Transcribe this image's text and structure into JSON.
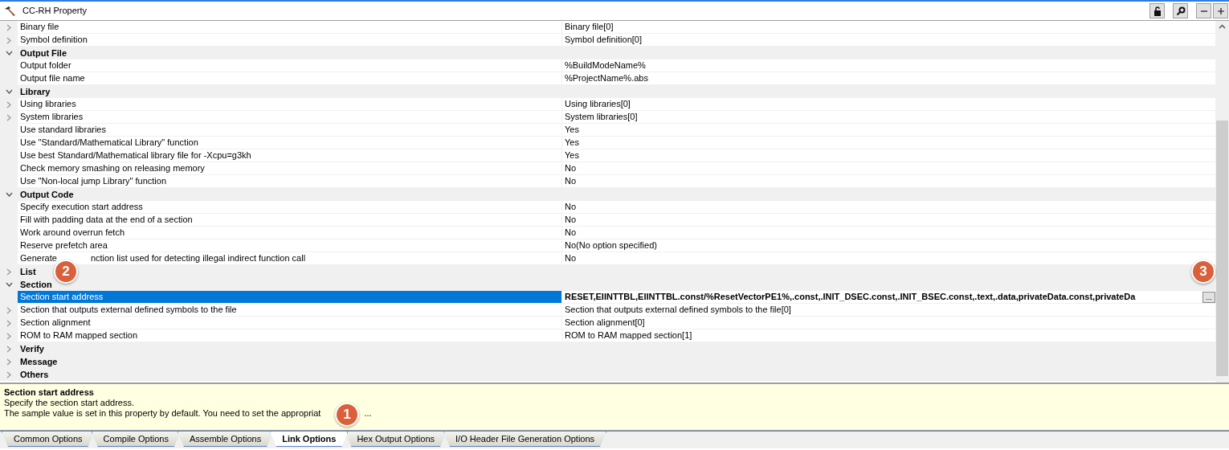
{
  "window": {
    "title": "CC-RH Property"
  },
  "toolbar": [
    {
      "kind": "lock"
    },
    {
      "kind": "search"
    },
    {
      "kind": "minus"
    },
    {
      "kind": "plus"
    }
  ],
  "rows": [
    {
      "kind": "property",
      "name": "Binary file",
      "value": "Binary file[0]",
      "expandable": true,
      "selected": false,
      "modified": false
    },
    {
      "kind": "property",
      "name": "Symbol definition",
      "value": "Symbol definition[0]",
      "expandable": true,
      "selected": false,
      "modified": false
    },
    {
      "kind": "category",
      "name": "Output File",
      "expanded": true
    },
    {
      "kind": "property",
      "name": "Output folder",
      "value": "%BuildModeName%",
      "expandable": false,
      "selected": false,
      "modified": false
    },
    {
      "kind": "property",
      "name": "Output file name",
      "value": "%ProjectName%.abs",
      "expandable": false,
      "selected": false,
      "modified": false
    },
    {
      "kind": "category",
      "name": "Library",
      "expanded": true
    },
    {
      "kind": "property",
      "name": "Using libraries",
      "value": "Using libraries[0]",
      "expandable": true,
      "selected": false,
      "modified": false
    },
    {
      "kind": "property",
      "name": "System libraries",
      "value": "System libraries[0]",
      "expandable": true,
      "selected": false,
      "modified": false
    },
    {
      "kind": "property",
      "name": "Use standard libraries",
      "value": "Yes",
      "expandable": false,
      "selected": false,
      "modified": false
    },
    {
      "kind": "property",
      "name": "Use \"Standard/Mathematical Library\" function",
      "value": "Yes",
      "expandable": false,
      "selected": false,
      "modified": false
    },
    {
      "kind": "property",
      "name": "Use best Standard/Mathematical library file for -Xcpu=g3kh",
      "value": "Yes",
      "expandable": false,
      "selected": false,
      "modified": false
    },
    {
      "kind": "property",
      "name": "Check memory smashing on releasing memory",
      "value": "No",
      "expandable": false,
      "selected": false,
      "modified": false
    },
    {
      "kind": "property",
      "name": "Use \"Non-local jump Library\" function",
      "value": "No",
      "expandable": false,
      "selected": false,
      "modified": false
    },
    {
      "kind": "category",
      "name": "Output Code",
      "expanded": true
    },
    {
      "kind": "property",
      "name": "Specify execution start address",
      "value": "No",
      "expandable": false,
      "selected": false,
      "modified": false
    },
    {
      "kind": "property",
      "name": "Fill with padding data at the end of a section",
      "value": "No",
      "expandable": false,
      "selected": false,
      "modified": false
    },
    {
      "kind": "property",
      "name": "Work around overrun fetch",
      "value": "No",
      "expandable": false,
      "selected": false,
      "modified": false
    },
    {
      "kind": "property",
      "name": "Reserve prefetch area",
      "value": "No(No option specified)",
      "expandable": false,
      "selected": false,
      "modified": false
    },
    {
      "kind": "property",
      "name": "Generate",
      "name_rest": "nction list used for detecting illegal indirect function call",
      "value": "No",
      "expandable": false,
      "selected": false,
      "modified": false
    },
    {
      "kind": "category",
      "name": "List",
      "expanded": false
    },
    {
      "kind": "category",
      "name": "Section",
      "expanded": true
    },
    {
      "kind": "property",
      "name": "Section start address",
      "value": "RESET,EIINTTBL,EIINTTBL.const/%ResetVectorPE1%,.const,.INIT_DSEC.const,.INIT_BSEC.const,.text,.data,privateData.const,privateDa",
      "expandable": false,
      "selected": true,
      "modified": true,
      "button": "..."
    },
    {
      "kind": "property",
      "name": "Section that outputs external defined symbols to the file",
      "value": "Section that outputs external defined symbols to the file[0]",
      "expandable": true,
      "selected": false,
      "modified": false
    },
    {
      "kind": "property",
      "name": "Section alignment",
      "value": "Section alignment[0]",
      "expandable": true,
      "selected": false,
      "modified": false
    },
    {
      "kind": "property",
      "name": "ROM to RAM mapped section",
      "value": "ROM to RAM mapped section[1]",
      "expandable": true,
      "selected": false,
      "modified": false
    },
    {
      "kind": "category",
      "name": "Verify",
      "expanded": false
    },
    {
      "kind": "category",
      "name": "Message",
      "expanded": false
    },
    {
      "kind": "category",
      "name": "Others",
      "expanded": false
    }
  ],
  "description": {
    "title": "Section start address",
    "lines": [
      "Specify the section start address.",
      "The sample value is set in this property by default. You need to set the appropriat"
    ],
    "tail": "..."
  },
  "tabs": [
    {
      "label": "Common Options",
      "selected": false
    },
    {
      "label": "Compile Options",
      "selected": false
    },
    {
      "label": "Assemble Options",
      "selected": false
    },
    {
      "label": "Link Options",
      "selected": true
    },
    {
      "label": "Hex Output Options",
      "selected": false
    },
    {
      "label": "I/O Header File Generation Options",
      "selected": false
    }
  ],
  "callouts": [
    {
      "label": "1"
    },
    {
      "label": "2"
    },
    {
      "label": "3"
    }
  ]
}
